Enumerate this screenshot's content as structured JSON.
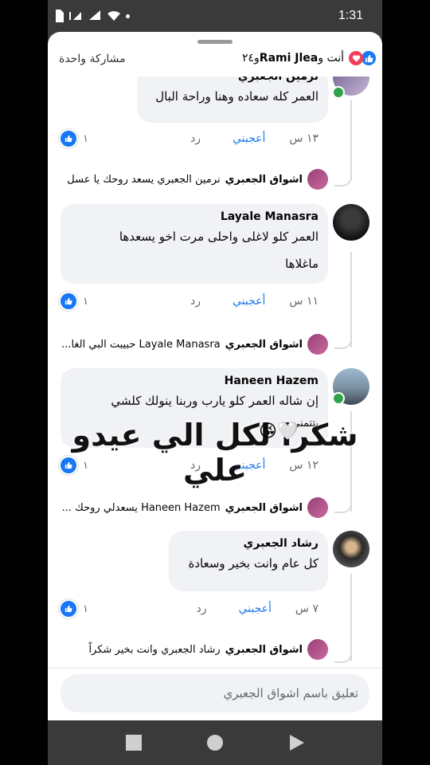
{
  "status_bar": {
    "time": "1:31"
  },
  "header": {
    "reactors_you": "أنت و",
    "reactors_name": "Rami Jlea",
    "reactors_more": "و٢٤",
    "shares": "مشاركة واحدة"
  },
  "comments": [
    {
      "name": "نرمين الجعبري",
      "text_lines": [
        "العمر كله سعاده وهنا وراحة البال"
      ],
      "time": "١٣ س",
      "like_label": "أعجبني",
      "reply_label": "رد",
      "likes": "١",
      "reply": {
        "name": "اشواق الجعبري",
        "text": "نرمين الجعبري يسعد روحك يا عسل"
      }
    },
    {
      "name": "Layale Manasra",
      "text_lines": [
        "العمر كلو لاغلى واحلى مرت اخو يسعدها",
        "ماغلاها"
      ],
      "time": "١١ س",
      "like_label": "أعجبني",
      "reply_label": "رد",
      "likes": "١",
      "reply": {
        "name": "اشواق الجعبري",
        "text": "Layale Manasra حبيبت البي الغا..."
      }
    },
    {
      "name": "Haneen Hazem",
      "text_lines": [
        "إن شاله العمر كلو يارب وربنا ينولك كلشي",
        "بتتمنى"
      ],
      "time": "١٢ س",
      "like_label": "أعجبني",
      "reply_label": "رد",
      "likes": "١",
      "reply": {
        "name": "اشواق الجعبري",
        "text": "Haneen Hazem يسعدلي روحك ..."
      }
    },
    {
      "name": "رشاد الجعبري",
      "text_lines": [
        "كل عام وانت بخير وسعادة"
      ],
      "time": "٧ س",
      "like_label": "أعجبني",
      "reply_label": "رد",
      "likes": "١",
      "reply": {
        "name": "اشواق الجعبري",
        "text": "رشاد الجعبري وانت بخير شكراً"
      }
    }
  ],
  "overlay_caption": "شكرا لكل الي عيدو علي",
  "composer": {
    "placeholder": "تعليق باسم اشواق الجعبري"
  },
  "colors": {
    "like_blue": "#1877f2",
    "love_red": "#f33e58",
    "bubble_gray": "#f0f2f5",
    "online_green": "#31a24c"
  }
}
